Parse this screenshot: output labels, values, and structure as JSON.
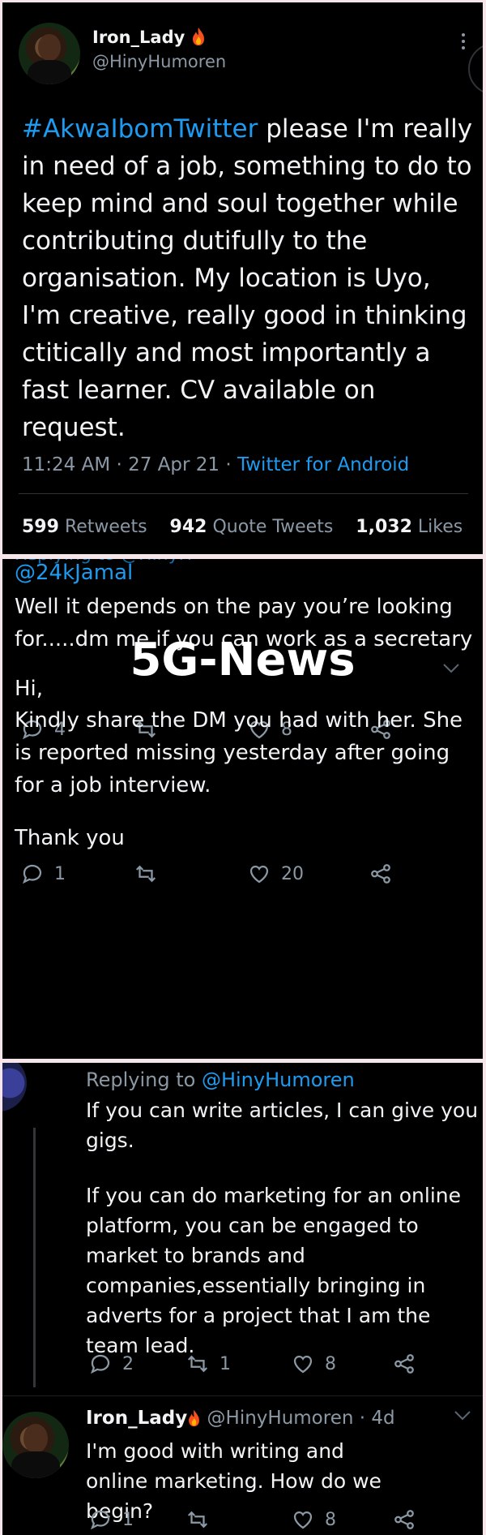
{
  "original_tweet": {
    "display_name": "Iron_Lady",
    "handle": "@HinyHumoren",
    "hashtag": "#AkwaIbomTwitter",
    "body": " please I'm really in need of a job, something to do to keep mind and soul together while contributing dutifully to the organisation. My location is Uyo, I'm creative, really good in thinking ctitically and most importantly a fast learner. CV available on request.",
    "time": "11:24 AM",
    "date": "27 Apr 21",
    "source": "Twitter for Android",
    "retweets_count": "599",
    "retweets_label": "Retweets",
    "quotes_count": "942",
    "quotes_label": "Quote Tweets",
    "likes_count": "1,032",
    "likes_label": "Likes"
  },
  "reply_jamal": {
    "mention": "@24kJamal",
    "body": "Well it depends on the pay you’re looking for.....dm me if you can work as a secretary",
    "replies": "4",
    "retweets": "",
    "likes": "8"
  },
  "watermark": "5G-News",
  "reply_news": {
    "greeting": "Hi,",
    "body": "Kindly share the DM you had with her. She is reported missing yesterday after going for a job interview.",
    "closing": "Thank you",
    "replies": "1",
    "retweets": "",
    "likes": "20"
  },
  "reply_gigs": {
    "replying_prefix": "Replying to ",
    "replying_to": "@HinyHumoren",
    "paragraph1": "If you can write articles, I can give you gigs.",
    "paragraph2": "If you can do marketing for an online platform, you can be engaged to market to brands and companies,essentially bringing in adverts for a project that I am the team lead.",
    "replies": "2",
    "retweets": "1",
    "likes": "8"
  },
  "reply_iron_lady": {
    "display_name": "Iron_Lady",
    "handle": "@HinyHumoren",
    "age": "· 4d",
    "body": "I'm good with writing and online marketing. How do we begin?",
    "replies": "1",
    "retweets": "",
    "likes": "8"
  },
  "icons": [
    "reply-icon",
    "retweet-icon",
    "like-icon",
    "share-icon",
    "more-icon",
    "chevron-down-icon",
    "fire-emoji-icon"
  ],
  "colors": {
    "background": "#000000",
    "link": "#1d9bf0",
    "muted": "#8b98a5",
    "text": "#f1f3f4"
  }
}
